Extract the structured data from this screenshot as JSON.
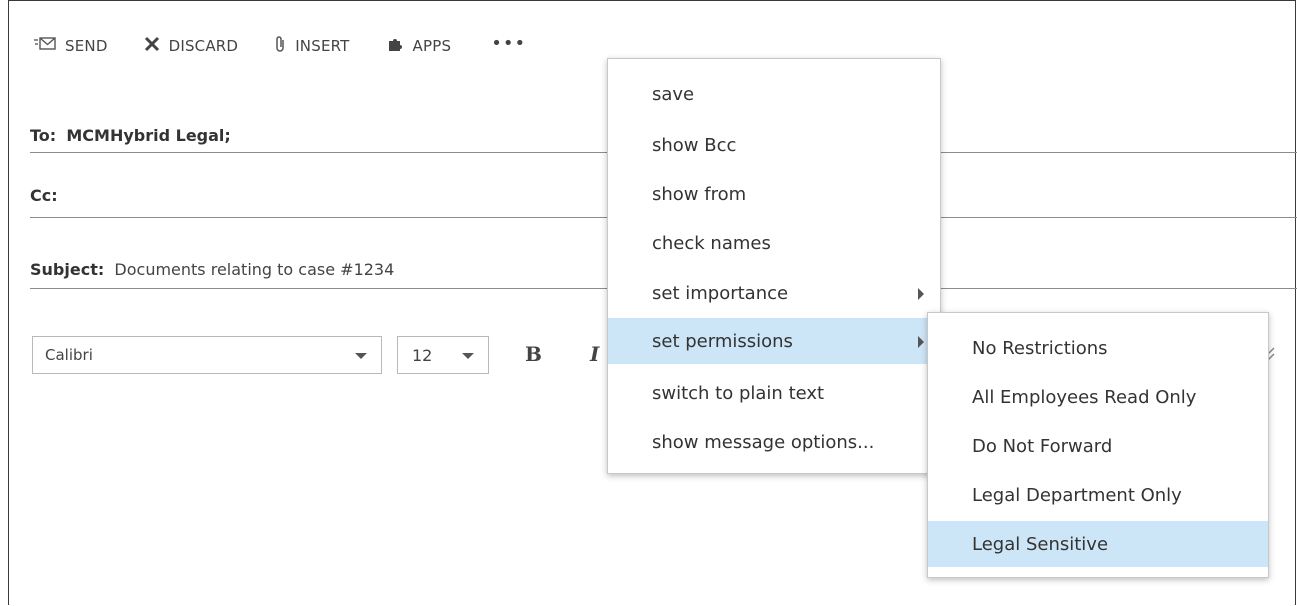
{
  "toolbar": {
    "send_label": "SEND",
    "discard_label": "DISCARD",
    "insert_label": "INSERT",
    "apps_label": "APPS",
    "more_label": "•••",
    "icons": [
      "send-mail-icon",
      "discard-x-icon",
      "paperclip-icon",
      "apps-puzzle-icon",
      "more-dots-icon"
    ]
  },
  "fields": {
    "to_label": "To:",
    "to_value": "MCMHybrid Legal;",
    "cc_label": "Cc:",
    "cc_value": "",
    "subject_label": "Subject:",
    "subject_value": "Documents relating to case #1234"
  },
  "format": {
    "font_value": "Calibri",
    "size_value": "12",
    "bold_label": "B",
    "italic_label": "I"
  },
  "more_menu": {
    "items": [
      {
        "label": "save",
        "has_submenu": false
      },
      {
        "label": "show Bcc",
        "has_submenu": false
      },
      {
        "label": "show from",
        "has_submenu": false
      },
      {
        "label": "check names",
        "has_submenu": false
      },
      {
        "label": "set importance",
        "has_submenu": true
      },
      {
        "label": "set permissions",
        "has_submenu": true,
        "highlighted": true
      },
      {
        "label": "switch to plain text",
        "has_submenu": false
      },
      {
        "label": "show message options...",
        "has_submenu": false
      }
    ]
  },
  "permissions_menu": {
    "items": [
      {
        "label": "No Restrictions"
      },
      {
        "label": "All Employees Read Only"
      },
      {
        "label": "Do Not Forward"
      },
      {
        "label": "Legal Department Only"
      },
      {
        "label": "Legal Sensitive",
        "highlighted": true
      }
    ]
  },
  "colors": {
    "highlight": "#cde6f7",
    "text": "#333333",
    "divider": "#8c8c8c"
  }
}
